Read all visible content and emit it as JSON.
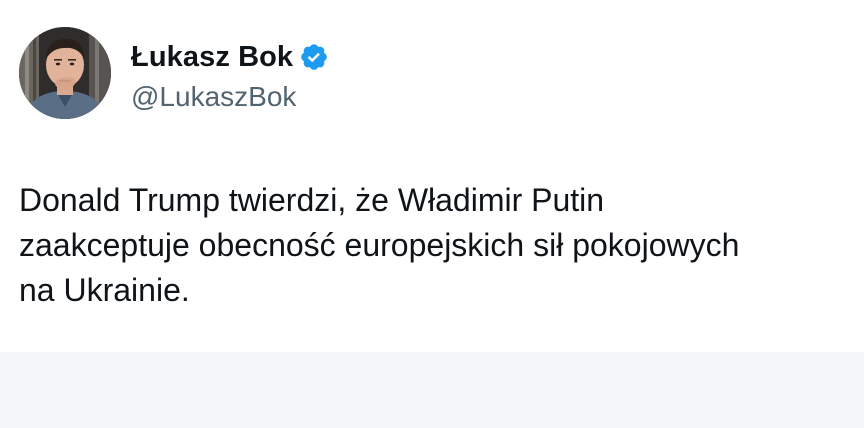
{
  "author": {
    "display_name": "Łukasz Bok",
    "handle": "@LukaszBok",
    "verified": true,
    "verified_color": "#1d9bf0"
  },
  "tweet": {
    "text": "Donald Trump twierdzi, że Władimir Putin\nzaakceptuje obecność europejskich sił pokojowych\nna Ukrainie."
  },
  "icons": {
    "avatar": "profile-photo",
    "verified": "verified-badge-icon"
  }
}
